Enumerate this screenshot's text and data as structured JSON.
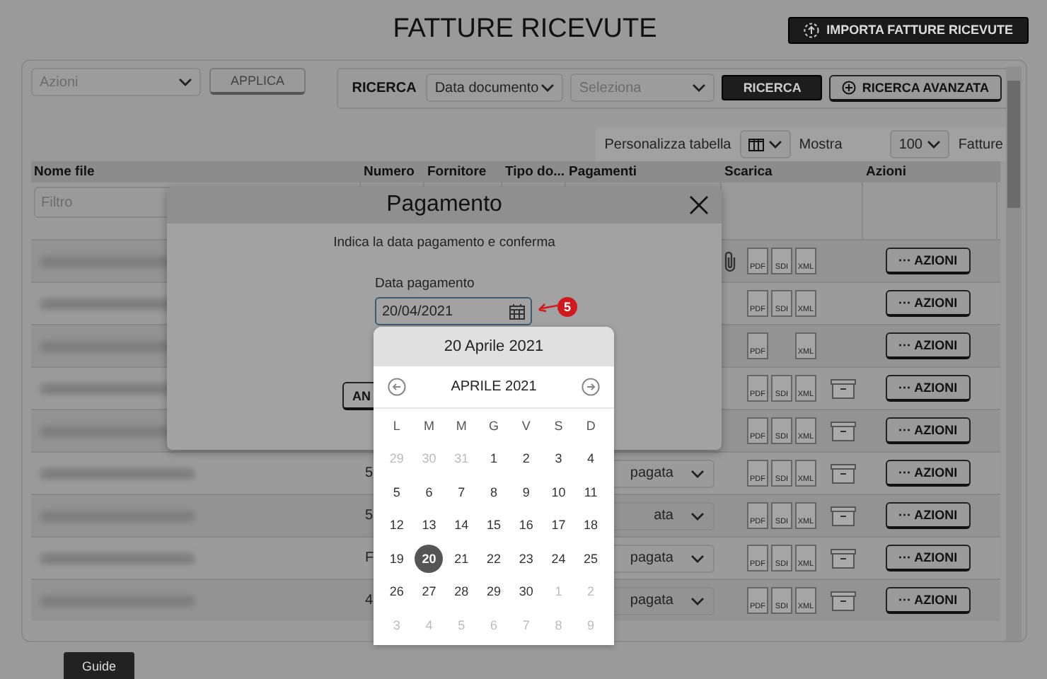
{
  "page_title": "FATTURE RICEVUTE",
  "import_button": "IMPORTA FATTURE RICEVUTE",
  "toolbar": {
    "actions_select": {
      "placeholder": "Azioni"
    },
    "apply_button": "APPLICA",
    "search_label": "RICERCA",
    "field_select": "Data documento",
    "value_select": {
      "placeholder": "Seleziona"
    },
    "search_button": "RICERCA",
    "advanced_button": "RICERCA AVANZATA"
  },
  "table_options": {
    "customize_label": "Personalizza tabella",
    "show_label": "Mostra",
    "page_size": "100",
    "unit_label": "Fatture"
  },
  "table": {
    "columns": [
      "Nome file",
      "Numero",
      "Fornitore",
      "Tipo do...",
      "Pagamenti",
      "Scarica",
      "Azioni"
    ],
    "filter_placeholder": "Filtro",
    "rows": [
      {
        "attachment": true,
        "archived": false,
        "downloads": [
          {
            "kind": "pdf",
            "label": "PDF"
          },
          {
            "kind": "sdi",
            "label": "SDI"
          },
          {
            "kind": "xml",
            "label": "XML"
          }
        ],
        "action": "··· AZIONI"
      },
      {
        "attachment": false,
        "archived": false,
        "downloads": [
          {
            "kind": "pdf",
            "label": "PDF"
          },
          {
            "kind": "sdi",
            "label": "SDI"
          },
          {
            "kind": "xml",
            "label": "XML"
          }
        ],
        "action": "··· AZIONI"
      },
      {
        "attachment": false,
        "archived": false,
        "downloads": [
          {
            "kind": "pdf",
            "label": "PDF"
          },
          {
            "kind": "xml",
            "label": "XML"
          }
        ],
        "action": "··· AZIONI"
      },
      {
        "attachment": false,
        "archived": true,
        "downloads": [
          {
            "kind": "pdf",
            "label": "PDF"
          },
          {
            "kind": "sdi",
            "label": "SDI"
          },
          {
            "kind": "xml",
            "label": "XML"
          }
        ],
        "action": "··· AZIONI"
      },
      {
        "attachment": false,
        "archived": true,
        "downloads": [
          {
            "kind": "pdf",
            "label": "PDF"
          },
          {
            "kind": "sdi",
            "label": "SDI"
          },
          {
            "kind": "xml",
            "label": "XML"
          }
        ],
        "action": "··· AZIONI"
      },
      {
        "numero": "5",
        "payment": "pagata",
        "attachment": false,
        "archived": true,
        "downloads": [
          {
            "kind": "pdf",
            "label": "PDF"
          },
          {
            "kind": "sdi",
            "label": "SDI"
          },
          {
            "kind": "xml",
            "label": "XML"
          }
        ],
        "action": "··· AZIONI"
      },
      {
        "numero": "5",
        "payment": "ata",
        "attachment": false,
        "archived": true,
        "downloads": [
          {
            "kind": "pdf",
            "label": "PDF"
          },
          {
            "kind": "sdi",
            "label": "SDI"
          },
          {
            "kind": "xml",
            "label": "XML"
          }
        ],
        "action": "··· AZIONI"
      },
      {
        "numero": "F",
        "payment": "pagata",
        "attachment": false,
        "archived": true,
        "downloads": [
          {
            "kind": "pdf",
            "label": "PDF"
          },
          {
            "kind": "sdi",
            "label": "SDI"
          },
          {
            "kind": "xml",
            "label": "XML"
          }
        ],
        "action": "··· AZIONI"
      },
      {
        "numero": "4",
        "payment": "pagata",
        "attachment": false,
        "archived": true,
        "downloads": [
          {
            "kind": "pdf",
            "label": "PDF"
          },
          {
            "kind": "sdi",
            "label": "SDI"
          },
          {
            "kind": "xml",
            "label": "XML"
          }
        ],
        "action": "··· AZIONI"
      }
    ]
  },
  "modal": {
    "title": "Pagamento",
    "message": "Indica la data pagamento e conferma",
    "date_label": "Data pagamento",
    "date_value": "20/04/2021",
    "step_badge": "5",
    "cancel_button": "AN"
  },
  "datepicker": {
    "selected_date": "20 Aprile 2021",
    "month": "APRILE 2021",
    "weekdays": [
      "L",
      "M",
      "M",
      "G",
      "V",
      "S",
      "D"
    ],
    "days": [
      {
        "label": "29",
        "outside": true,
        "selected": false
      },
      {
        "label": "30",
        "outside": true,
        "selected": false
      },
      {
        "label": "31",
        "outside": true,
        "selected": false
      },
      {
        "label": "1",
        "outside": false,
        "selected": false
      },
      {
        "label": "2",
        "outside": false,
        "selected": false
      },
      {
        "label": "3",
        "outside": false,
        "selected": false
      },
      {
        "label": "4",
        "outside": false,
        "selected": false
      },
      {
        "label": "5",
        "outside": false,
        "selected": false
      },
      {
        "label": "6",
        "outside": false,
        "selected": false
      },
      {
        "label": "7",
        "outside": false,
        "selected": false
      },
      {
        "label": "8",
        "outside": false,
        "selected": false
      },
      {
        "label": "9",
        "outside": false,
        "selected": false
      },
      {
        "label": "10",
        "outside": false,
        "selected": false
      },
      {
        "label": "11",
        "outside": false,
        "selected": false
      },
      {
        "label": "12",
        "outside": false,
        "selected": false
      },
      {
        "label": "13",
        "outside": false,
        "selected": false
      },
      {
        "label": "14",
        "outside": false,
        "selected": false
      },
      {
        "label": "15",
        "outside": false,
        "selected": false
      },
      {
        "label": "16",
        "outside": false,
        "selected": false
      },
      {
        "label": "17",
        "outside": false,
        "selected": false
      },
      {
        "label": "18",
        "outside": false,
        "selected": false
      },
      {
        "label": "19",
        "outside": false,
        "selected": false
      },
      {
        "label": "20",
        "outside": false,
        "selected": true
      },
      {
        "label": "21",
        "outside": false,
        "selected": false
      },
      {
        "label": "22",
        "outside": false,
        "selected": false
      },
      {
        "label": "23",
        "outside": false,
        "selected": false
      },
      {
        "label": "24",
        "outside": false,
        "selected": false
      },
      {
        "label": "25",
        "outside": false,
        "selected": false
      },
      {
        "label": "26",
        "outside": false,
        "selected": false
      },
      {
        "label": "27",
        "outside": false,
        "selected": false
      },
      {
        "label": "28",
        "outside": false,
        "selected": false
      },
      {
        "label": "29",
        "outside": false,
        "selected": false
      },
      {
        "label": "30",
        "outside": false,
        "selected": false
      },
      {
        "label": "1",
        "outside": true,
        "selected": false
      },
      {
        "label": "2",
        "outside": true,
        "selected": false
      },
      {
        "label": "3",
        "outside": true,
        "selected": false
      },
      {
        "label": "4",
        "outside": true,
        "selected": false
      },
      {
        "label": "5",
        "outside": true,
        "selected": false
      },
      {
        "label": "6",
        "outside": true,
        "selected": false
      },
      {
        "label": "7",
        "outside": true,
        "selected": false
      },
      {
        "label": "8",
        "outside": true,
        "selected": false
      },
      {
        "label": "9",
        "outside": true,
        "selected": false
      }
    ]
  },
  "guide_tab": "Guide"
}
